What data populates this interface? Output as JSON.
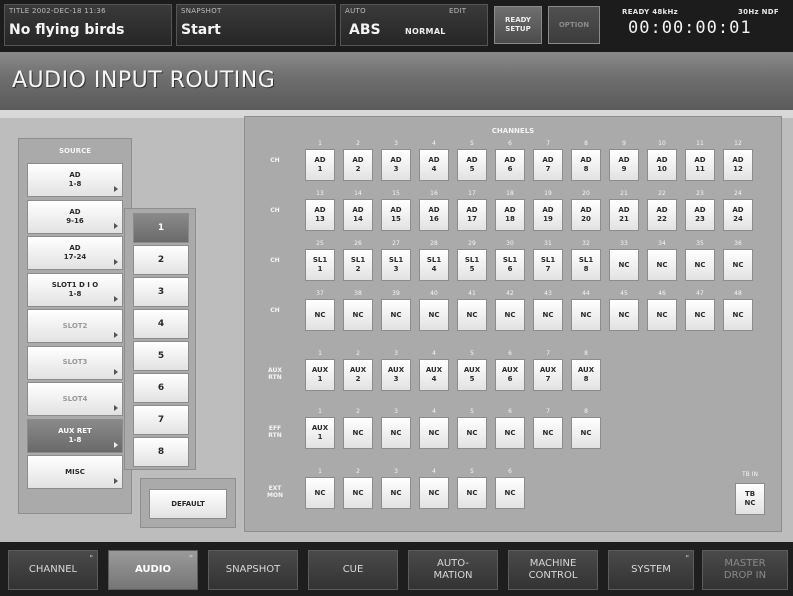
{
  "topbar": {
    "title_caption": "TITLE 2002-DEC-18 11:36",
    "title_value": "No flying birds",
    "snapshot_caption": "SNAPSHOT",
    "snapshot_value": "Start",
    "auto_caption": "AUTO",
    "auto_value": "ABS",
    "mode_caption": "EDIT",
    "mode_value": "NORMAL",
    "ready_setup_line1": "READY",
    "ready_setup_line2": "SETUP",
    "option_label": "OPTION",
    "status_caption": "READY 48kHz",
    "rate_caption": "30Hz NDF",
    "timecode": "00:00:00:01"
  },
  "page_title": "AUDIO INPUT ROUTING",
  "source": {
    "title": "SOURCE",
    "items": [
      {
        "line1": "AD",
        "line2": "1-8",
        "state": "normal"
      },
      {
        "line1": "AD",
        "line2": "9-16",
        "state": "normal"
      },
      {
        "line1": "AD",
        "line2": "17-24",
        "state": "normal"
      },
      {
        "line1": "SLOT1 D I O",
        "line2": "1-8",
        "state": "normal"
      },
      {
        "line1": "SLOT2",
        "line2": "",
        "state": "grey"
      },
      {
        "line1": "SLOT3",
        "line2": "",
        "state": "grey"
      },
      {
        "line1": "SLOT4",
        "line2": "",
        "state": "grey"
      },
      {
        "line1": "AUX RET",
        "line2": "1-8",
        "state": "selected"
      },
      {
        "line1": "MISC",
        "line2": "",
        "state": "normal"
      }
    ]
  },
  "numbers": {
    "items": [
      {
        "label": "1",
        "state": "selected"
      },
      {
        "label": "2",
        "state": "normal"
      },
      {
        "label": "3",
        "state": "normal"
      },
      {
        "label": "4",
        "state": "normal"
      },
      {
        "label": "5",
        "state": "normal"
      },
      {
        "label": "6",
        "state": "normal"
      },
      {
        "label": "7",
        "state": "normal"
      },
      {
        "label": "8",
        "state": "normal"
      }
    ]
  },
  "default_label": "DEFAULT",
  "channels": {
    "title": "CHANNELS",
    "rows": [
      {
        "label_line1": "CH",
        "label_line2": "",
        "nums": [
          "1",
          "2",
          "3",
          "4",
          "5",
          "6",
          "7",
          "8",
          "9",
          "10",
          "11",
          "12"
        ],
        "cells": [
          [
            "AD",
            "1"
          ],
          [
            "AD",
            "2"
          ],
          [
            "AD",
            "3"
          ],
          [
            "AD",
            "4"
          ],
          [
            "AD",
            "5"
          ],
          [
            "AD",
            "6"
          ],
          [
            "AD",
            "7"
          ],
          [
            "AD",
            "8"
          ],
          [
            "AD",
            "9"
          ],
          [
            "AD",
            "10"
          ],
          [
            "AD",
            "11"
          ],
          [
            "AD",
            "12"
          ]
        ]
      },
      {
        "label_line1": "CH",
        "label_line2": "",
        "nums": [
          "13",
          "14",
          "15",
          "16",
          "17",
          "18",
          "19",
          "20",
          "21",
          "22",
          "23",
          "24"
        ],
        "cells": [
          [
            "AD",
            "13"
          ],
          [
            "AD",
            "14"
          ],
          [
            "AD",
            "15"
          ],
          [
            "AD",
            "16"
          ],
          [
            "AD",
            "17"
          ],
          [
            "AD",
            "18"
          ],
          [
            "AD",
            "19"
          ],
          [
            "AD",
            "20"
          ],
          [
            "AD",
            "21"
          ],
          [
            "AD",
            "22"
          ],
          [
            "AD",
            "23"
          ],
          [
            "AD",
            "24"
          ]
        ]
      },
      {
        "label_line1": "CH",
        "label_line2": "",
        "nums": [
          "25",
          "26",
          "27",
          "28",
          "29",
          "30",
          "31",
          "32",
          "33",
          "34",
          "35",
          "36"
        ],
        "cells": [
          [
            "SL1",
            "1"
          ],
          [
            "SL1",
            "2"
          ],
          [
            "SL1",
            "3"
          ],
          [
            "SL1",
            "4"
          ],
          [
            "SL1",
            "5"
          ],
          [
            "SL1",
            "6"
          ],
          [
            "SL1",
            "7"
          ],
          [
            "SL1",
            "8"
          ],
          [
            "NC",
            ""
          ],
          [
            "NC",
            ""
          ],
          [
            "NC",
            ""
          ],
          [
            "NC",
            ""
          ]
        ]
      },
      {
        "label_line1": "CH",
        "label_line2": "",
        "nums": [
          "37",
          "38",
          "39",
          "40",
          "41",
          "42",
          "43",
          "44",
          "45",
          "46",
          "47",
          "48"
        ],
        "cells": [
          [
            "NC",
            ""
          ],
          [
            "NC",
            ""
          ],
          [
            "NC",
            ""
          ],
          [
            "NC",
            ""
          ],
          [
            "NC",
            ""
          ],
          [
            "NC",
            ""
          ],
          [
            "NC",
            ""
          ],
          [
            "NC",
            ""
          ],
          [
            "NC",
            ""
          ],
          [
            "NC",
            ""
          ],
          [
            "NC",
            ""
          ],
          [
            "NC",
            ""
          ]
        ]
      },
      {
        "label_line1": "AUX",
        "label_line2": "RTN",
        "nums": [
          "1",
          "2",
          "3",
          "4",
          "5",
          "6",
          "7",
          "8"
        ],
        "cells": [
          [
            "AUX",
            "1"
          ],
          [
            "AUX",
            "2"
          ],
          [
            "AUX",
            "3"
          ],
          [
            "AUX",
            "4"
          ],
          [
            "AUX",
            "5"
          ],
          [
            "AUX",
            "6"
          ],
          [
            "AUX",
            "7"
          ],
          [
            "AUX",
            "8"
          ]
        ]
      },
      {
        "label_line1": "EFF",
        "label_line2": "RTN",
        "nums": [
          "1",
          "2",
          "3",
          "4",
          "5",
          "6",
          "7",
          "8"
        ],
        "cells": [
          [
            "AUX",
            "1"
          ],
          [
            "NC",
            ""
          ],
          [
            "NC",
            ""
          ],
          [
            "NC",
            ""
          ],
          [
            "NC",
            ""
          ],
          [
            "NC",
            ""
          ],
          [
            "NC",
            ""
          ],
          [
            "NC",
            ""
          ]
        ]
      },
      {
        "label_line1": "EXT",
        "label_line2": "MON",
        "nums": [
          "1",
          "2",
          "3",
          "4",
          "5",
          "6"
        ],
        "cells": [
          [
            "NC",
            ""
          ],
          [
            "NC",
            ""
          ],
          [
            "NC",
            ""
          ],
          [
            "NC",
            ""
          ],
          [
            "NC",
            ""
          ],
          [
            "NC",
            ""
          ]
        ]
      }
    ],
    "tb_in": {
      "caption": "TB IN",
      "line1": "TB",
      "line2": "NC"
    }
  },
  "nav": {
    "items": [
      {
        "line1": "CHANNEL",
        "line2": "",
        "state": "normal",
        "mark": "\""
      },
      {
        "line1": "AUDIO",
        "line2": "",
        "state": "active",
        "mark": "\""
      },
      {
        "line1": "SNAPSHOT",
        "line2": "",
        "state": "normal",
        "mark": ""
      },
      {
        "line1": "CUE",
        "line2": "",
        "state": "normal",
        "mark": ""
      },
      {
        "line1": "AUTO-",
        "line2": "MATION",
        "state": "normal",
        "mark": ""
      },
      {
        "line1": "MACHINE",
        "line2": "CONTROL",
        "state": "normal",
        "mark": ""
      },
      {
        "line1": "SYSTEM",
        "line2": "",
        "state": "normal",
        "mark": "\""
      },
      {
        "line1": "MASTER",
        "line2": "DROP IN",
        "state": "dim",
        "mark": ""
      }
    ]
  }
}
